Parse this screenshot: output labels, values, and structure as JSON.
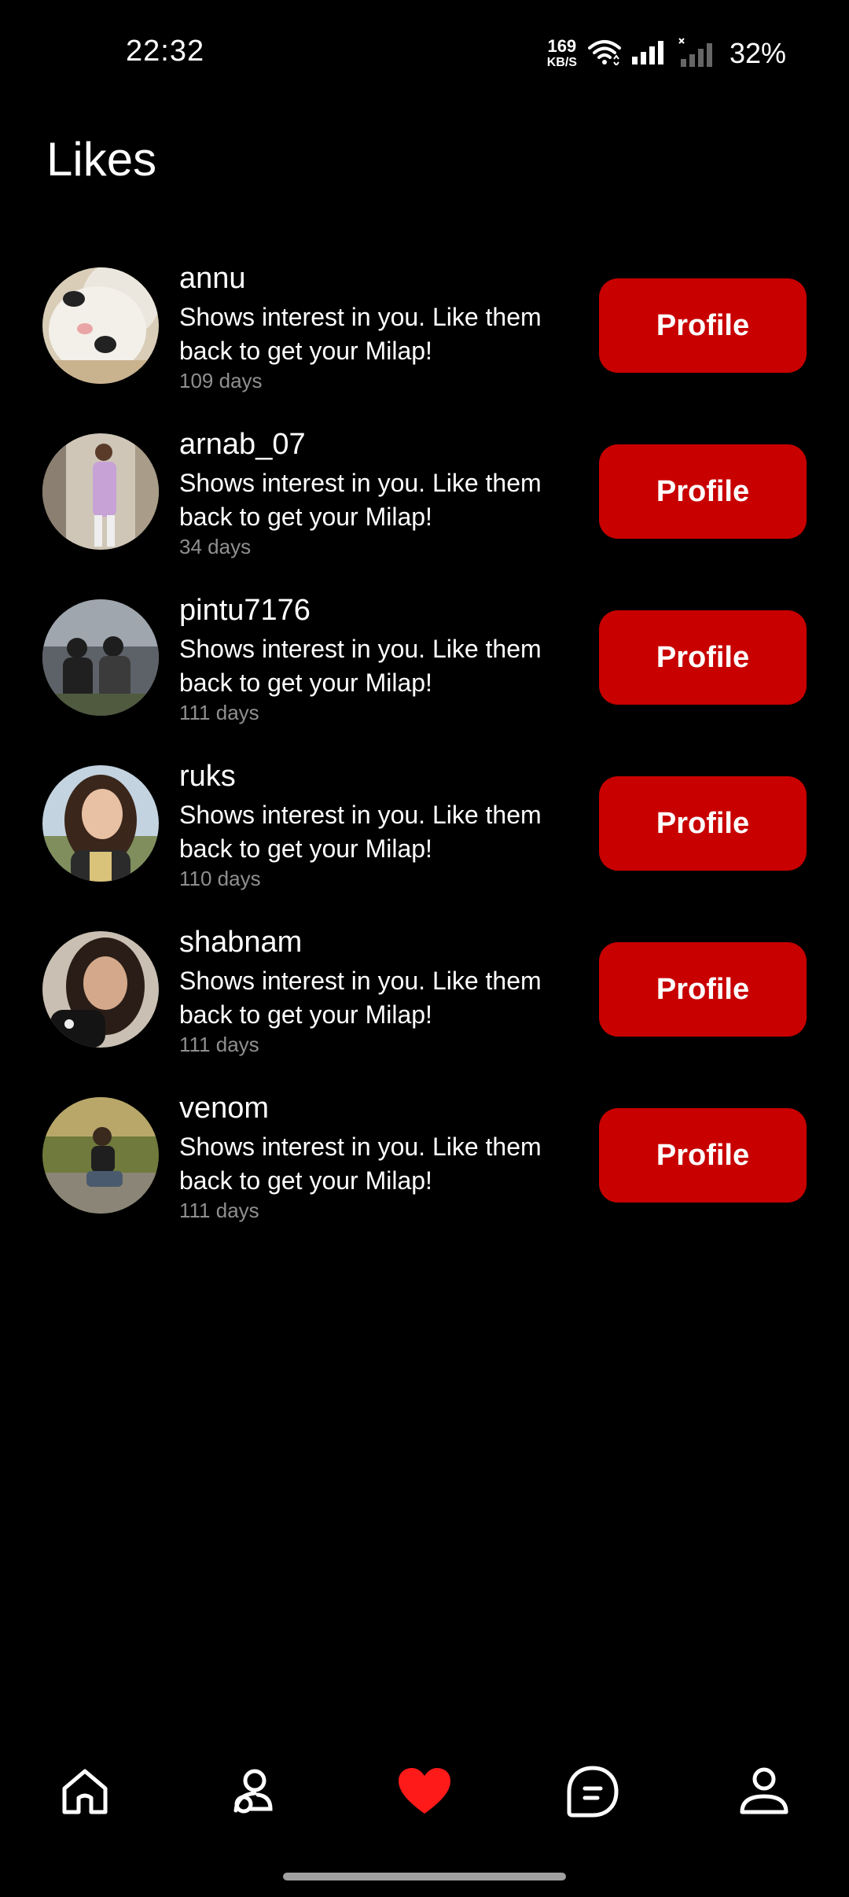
{
  "status_bar": {
    "time": "22:32",
    "net_speed_value": "169",
    "net_speed_unit": "KB/S",
    "battery": "32%"
  },
  "header": {
    "title": "Likes"
  },
  "likes": [
    {
      "name": "annu",
      "message": "Shows interest in you. Like them back to get your Milap!",
      "days": "109 days",
      "button": "Profile"
    },
    {
      "name": "arnab_07",
      "message": "Shows interest in you. Like them back to get your Milap!",
      "days": "34 days",
      "button": "Profile"
    },
    {
      "name": "pintu7176",
      "message": "Shows interest in you. Like them back to get your Milap!",
      "days": "111 days",
      "button": "Profile"
    },
    {
      "name": "ruks",
      "message": "Shows interest in you. Like them back to get your Milap!",
      "days": "110 days",
      "button": "Profile"
    },
    {
      "name": "shabnam",
      "message": "Shows interest in you. Like them back to get your Milap!",
      "days": "111 days",
      "button": "Profile"
    },
    {
      "name": "venom",
      "message": "Shows interest in you. Like them back to get your Milap!",
      "days": "111 days",
      "button": "Profile"
    }
  ],
  "bottom_nav": {
    "items": [
      {
        "icon": "home-icon",
        "active": false
      },
      {
        "icon": "people-icon",
        "active": false
      },
      {
        "icon": "heart-icon",
        "active": true
      },
      {
        "icon": "chat-icon",
        "active": false
      },
      {
        "icon": "user-icon",
        "active": false
      }
    ]
  },
  "colors": {
    "background": "#000000",
    "accent": "#c80000",
    "active_nav": "#ff1a1a",
    "muted_text": "#8f8f8f"
  }
}
